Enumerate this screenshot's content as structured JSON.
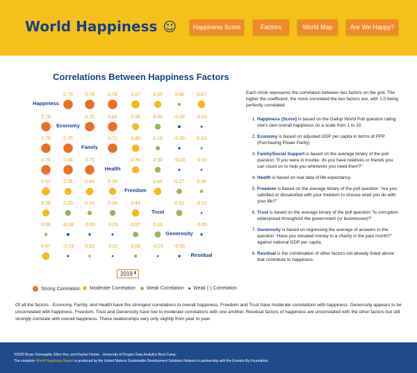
{
  "header": {
    "title": "World Happiness",
    "emoji": "☺",
    "nav": [
      {
        "label": "Happiness Score"
      },
      {
        "label": "Factors"
      },
      {
        "label": "World Map"
      },
      {
        "label": "Are We Happy?"
      }
    ]
  },
  "matrix": {
    "title": "Correlations Between Happiness Factors",
    "variables": [
      "Happiness",
      "Economy",
      "Family",
      "Health",
      "Freedom",
      "Trust",
      "Generosity",
      "Residual"
    ],
    "values": [
      [
        null,
        0.79,
        0.78,
        0.78,
        0.57,
        0.39,
        0.08,
        0.47
      ],
      [
        0.79,
        null,
        0.75,
        0.84,
        0.38,
        0.3,
        -0.08,
        -0.03
      ],
      [
        0.78,
        0.75,
        null,
        0.72,
        0.45,
        0.18,
        -0.05,
        0.03
      ],
      [
        0.78,
        0.84,
        0.72,
        null,
        0.39,
        0.3,
        -0.03,
        -0.01
      ],
      [
        0.57,
        0.38,
        0.45,
        0.39,
        null,
        0.44,
        0.27,
        0.08
      ],
      [
        0.39,
        0.3,
        0.18,
        0.3,
        0.44,
        null,
        0.33,
        -0.01
      ],
      [
        0.08,
        -0.08,
        -0.05,
        -0.03,
        0.27,
        0.33,
        null,
        -0.05
      ],
      [
        0.47,
        -0.03,
        0.03,
        -0.01,
        0.08,
        -0.01,
        -0.05,
        null
      ]
    ],
    "colors": {
      "strong": "#e86f2a",
      "moderate": "#f2b91a",
      "weak": "#9cb55a",
      "negative": "#1f5a8a"
    }
  },
  "year_select": {
    "value": "2019",
    "arrows": "⬍"
  },
  "legend": [
    {
      "label": "Strong Correlation",
      "color": "#e86f2a"
    },
    {
      "label": "Moderate Correlation",
      "color": "#f2b91a"
    },
    {
      "label": "Weak Correlation",
      "color": "#9cb55a"
    },
    {
      "label": "Weak (-) Correlation",
      "color": "#1f5a8a"
    }
  ],
  "explanation": {
    "intro": "Each circle represents the correlation between two factors on the grid. The higher the coefficient, the more correlated the two factors are, with 1.0 being perfectly correlated.",
    "items": [
      {
        "term": "Happiness (Score)",
        "text": " is based on the Gallup World Poll question rating one's own overall happiness on a scale from 1 to 10."
      },
      {
        "term": "Economy",
        "text": " is based on adjusted GDP per capita in terms of PPP (Purchasing Power Parity)."
      },
      {
        "term": "Family/Social Support",
        "text": " is based on the average binary of the poll question \"If you were in trouble, do you have relatives or friends you can count on to help you whenever you need them?\""
      },
      {
        "term": "Health",
        "text": " is based on real data of life expectancy."
      },
      {
        "term": "Freedom",
        "text": " is based on the average binary of the poll question \"Are you satisfied or dissatisfied with your freedom to choose what you do with your life?\""
      },
      {
        "term": "Trust",
        "text": " is based on the average binary of the poll question \"Is corruption widespread throughout the government (or businesses)?\""
      },
      {
        "term": "Generosity",
        "text": " is based on regressing the average of answers to the question \"Have you donated money to a charity in the past month?\" against national GDP per capita."
      },
      {
        "term": "Residual",
        "text": " is the combination of other factors not already listed above that contribute to happiness."
      }
    ]
  },
  "summary": "Of all the factors - Economy, Family, and Health have the strongest correlations to overall happiness. Freedom and Trust have moderate correlations with happiness. Generosity appears to be uncorrelated with happiness. Freedom, Trust and Generosity have low to moderate correlations with one another. Residual factors of happiness are uncorrelated with the other factors but still strongly correlate with overall happiness. These relationships vary only slightly from year to year.",
  "footer": {
    "credits": "©2020 Bryan Domogalla, Ellen Hsu, and Rachel Hunter - University of Oregon Data Analytics Boot Camp.",
    "report_prefix": "The complete ",
    "report_link": "World Happiness Report",
    "report_suffix": " is produced by the United Nations Sustainable Development Solutions Network in partnership with the Ernesto Illy Foundation."
  }
}
